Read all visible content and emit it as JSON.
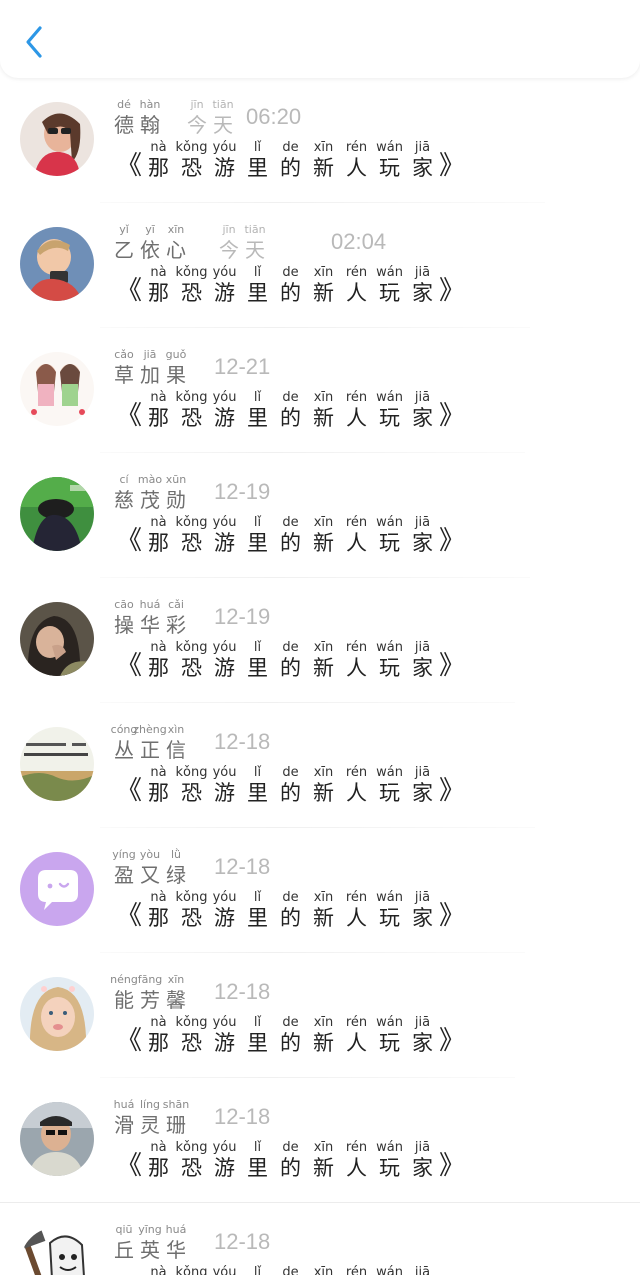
{
  "header": {
    "back_icon": "chevron-left-icon",
    "accent": "#2d97e6"
  },
  "title": {
    "open": "《",
    "close": "》",
    "chars": [
      {
        "py": "nà",
        "hz": "那"
      },
      {
        "py": "kǒng",
        "hz": "恐"
      },
      {
        "py": "yóu",
        "hz": "游"
      },
      {
        "py": "lǐ",
        "hz": "里"
      },
      {
        "py": "de",
        "hz": "的"
      },
      {
        "py": "xīn",
        "hz": "新"
      },
      {
        "py": "rén",
        "hz": "人"
      },
      {
        "py": "wán",
        "hz": "玩"
      },
      {
        "py": "jiā",
        "hz": "家"
      }
    ]
  },
  "items": [
    {
      "name": [
        {
          "py": "dé",
          "hz": "德"
        },
        {
          "py": "hàn",
          "hz": "翰"
        }
      ],
      "day": [
        {
          "py": "jīn",
          "hz": "今"
        },
        {
          "py": "tiān",
          "hz": "天"
        }
      ],
      "time": "06:20",
      "avatar": "avatar-girl-sunglasses"
    },
    {
      "name": [
        {
          "py": "yǐ",
          "hz": "乙"
        },
        {
          "py": "yī",
          "hz": "依"
        },
        {
          "py": "xīn",
          "hz": "心"
        }
      ],
      "day": [
        {
          "py": "jīn",
          "hz": "今"
        },
        {
          "py": "tiān",
          "hz": "天"
        }
      ],
      "time": "02:04",
      "avatar": "avatar-boy-phone"
    },
    {
      "name": [
        {
          "py": "cǎo",
          "hz": "草"
        },
        {
          "py": "jiā",
          "hz": "加"
        },
        {
          "py": "guǒ",
          "hz": "果"
        }
      ],
      "time": "12-21",
      "avatar": "avatar-cartoon-girls"
    },
    {
      "name": [
        {
          "py": "cí",
          "hz": "慈"
        },
        {
          "py": "mào",
          "hz": "茂"
        },
        {
          "py": "xūn",
          "hz": "勋"
        }
      ],
      "time": "12-19",
      "avatar": "avatar-cap-green"
    },
    {
      "name": [
        {
          "py": "cāo",
          "hz": "操"
        },
        {
          "py": "huá",
          "hz": "华"
        },
        {
          "py": "cǎi",
          "hz": "彩"
        }
      ],
      "time": "12-19",
      "avatar": "avatar-girl-portrait"
    },
    {
      "name": [
        {
          "py": "cóng",
          "hz": "丛"
        },
        {
          "py": "zhèng",
          "hz": "正"
        },
        {
          "py": "xìn",
          "hz": "信"
        }
      ],
      "time": "12-18",
      "avatar": "avatar-text-landscape"
    },
    {
      "name": [
        {
          "py": "yíng",
          "hz": "盈"
        },
        {
          "py": "yòu",
          "hz": "又"
        },
        {
          "py": "lǜ",
          "hz": "绿"
        }
      ],
      "time": "12-18",
      "avatar": "avatar-chat-bubble"
    },
    {
      "name": [
        {
          "py": "néng",
          "hz": "能"
        },
        {
          "py": "fāng",
          "hz": "芳"
        },
        {
          "py": "xīn",
          "hz": "馨"
        }
      ],
      "time": "12-18",
      "avatar": "avatar-little-girl"
    },
    {
      "name": [
        {
          "py": "huá",
          "hz": "滑"
        },
        {
          "py": "líng",
          "hz": "灵"
        },
        {
          "py": "shān",
          "hz": "珊"
        }
      ],
      "time": "12-18",
      "avatar": "avatar-man-sunglasses"
    },
    {
      "name": [
        {
          "py": "qiū",
          "hz": "丘"
        },
        {
          "py": "yīng",
          "hz": "英"
        },
        {
          "py": "huá",
          "hz": "华"
        }
      ],
      "time": "12-18",
      "avatar": "avatar-cartoon-hammer"
    }
  ]
}
